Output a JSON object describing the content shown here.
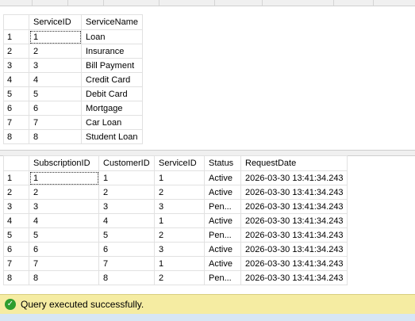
{
  "colors": {
    "status_bar": "#f5eca2",
    "success_icon": "#2e9e2e"
  },
  "grid1": {
    "columns": [
      "",
      "ServiceID",
      "ServiceName"
    ],
    "rows": [
      [
        "1",
        "1",
        "Loan"
      ],
      [
        "2",
        "2",
        "Insurance"
      ],
      [
        "3",
        "3",
        "Bill Payment"
      ],
      [
        "4",
        "4",
        "Credit Card"
      ],
      [
        "5",
        "5",
        "Debit Card"
      ],
      [
        "6",
        "6",
        "Mortgage"
      ],
      [
        "7",
        "7",
        "Car Loan"
      ],
      [
        "8",
        "8",
        "Student Loan"
      ]
    ]
  },
  "grid2": {
    "columns": [
      "",
      "SubscriptionID",
      "CustomerID",
      "ServiceID",
      "Status",
      "RequestDate"
    ],
    "rows": [
      [
        "1",
        "1",
        "1",
        "1",
        "Active",
        "2026-03-30 13:41:34.243"
      ],
      [
        "2",
        "2",
        "2",
        "2",
        "Active",
        "2026-03-30 13:41:34.243"
      ],
      [
        "3",
        "3",
        "3",
        "3",
        "Pen...",
        "2026-03-30 13:41:34.243"
      ],
      [
        "4",
        "4",
        "4",
        "1",
        "Active",
        "2026-03-30 13:41:34.243"
      ],
      [
        "5",
        "5",
        "5",
        "2",
        "Pen...",
        "2026-03-30 13:41:34.243"
      ],
      [
        "6",
        "6",
        "6",
        "3",
        "Active",
        "2026-03-30 13:41:34.243"
      ],
      [
        "7",
        "7",
        "7",
        "1",
        "Active",
        "2026-03-30 13:41:34.243"
      ],
      [
        "8",
        "8",
        "8",
        "2",
        "Pen...",
        "2026-03-30 13:41:34.243"
      ]
    ]
  },
  "status": {
    "message": "Query executed successfully.",
    "icon": "check-circle-icon"
  }
}
